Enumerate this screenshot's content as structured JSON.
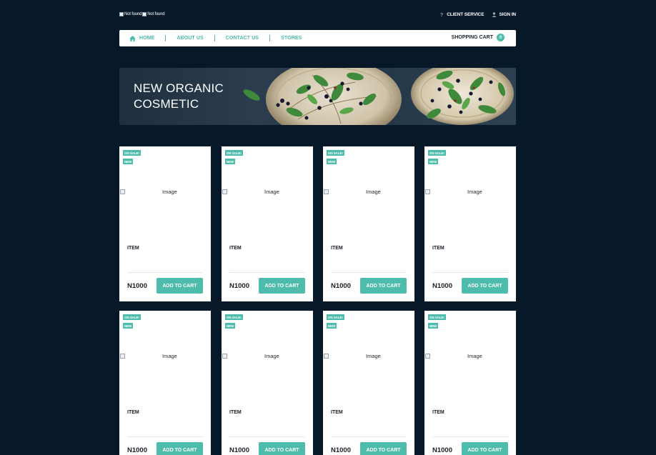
{
  "header": {
    "logos": [
      {
        "alt": "Not found"
      },
      {
        "alt": "Not found"
      }
    ],
    "links": [
      {
        "icon": "question-icon",
        "label": "CLIENT SERVICE"
      },
      {
        "icon": "user-icon",
        "label": "SIGN IN"
      }
    ]
  },
  "nav": {
    "items": [
      {
        "label": "HOME",
        "icon": "home-icon"
      },
      {
        "label": "ABOUT US"
      },
      {
        "label": "CONTACT US"
      },
      {
        "label": "STORES"
      }
    ],
    "cart_label": "SHOPPING CART",
    "cart_count": "0"
  },
  "banner": {
    "title": "NEW ORGANIC COSMETIC"
  },
  "colors": {
    "background": "#071829",
    "accent": "#4dbcaa"
  },
  "products": [
    {
      "badge_sale": "ON SALE!",
      "badge_new": "NEW",
      "image_alt": "Image",
      "name": "ITEM",
      "price": "N1000",
      "button": "ADD TO CART"
    },
    {
      "badge_sale": "ON SALE!",
      "badge_new": "NEW",
      "image_alt": "Image",
      "name": "ITEM",
      "price": "N1000",
      "button": "ADD TO CART"
    },
    {
      "badge_sale": "ON SALE!",
      "badge_new": "NEW",
      "image_alt": "Image",
      "name": "ITEM",
      "price": "N1000",
      "button": "ADD TO CART"
    },
    {
      "badge_sale": "ON SALE!",
      "badge_new": "NEW",
      "image_alt": "Image",
      "name": "ITEM",
      "price": "N1000",
      "button": "ADD TO CART"
    },
    {
      "badge_sale": "ON SALE!",
      "badge_new": "NEW",
      "image_alt": "Image",
      "name": "ITEM",
      "price": "N1000",
      "button": "ADD TO CART"
    },
    {
      "badge_sale": "ON SALE!",
      "badge_new": "NEW",
      "image_alt": "Image",
      "name": "ITEM",
      "price": "N1000",
      "button": "ADD TO CART"
    },
    {
      "badge_sale": "ON SALE!",
      "badge_new": "NEW",
      "image_alt": "Image",
      "name": "ITEM",
      "price": "N1000",
      "button": "ADD TO CART"
    },
    {
      "badge_sale": "ON SALE!",
      "badge_new": "NEW",
      "image_alt": "Image",
      "name": "ITEM",
      "price": "N1000",
      "button": "ADD TO CART"
    }
  ]
}
